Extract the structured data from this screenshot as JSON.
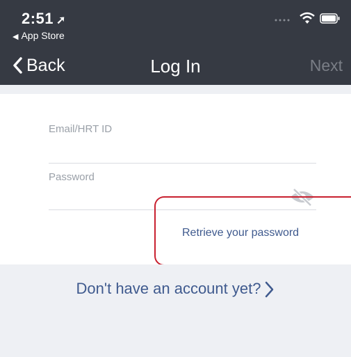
{
  "status": {
    "time": "2:51",
    "location_arrow": "➚",
    "back_app": "App Store"
  },
  "nav": {
    "back_label": "Back",
    "title": "Log In",
    "next_label": "Next"
  },
  "form": {
    "email_placeholder": "Email/HRT ID",
    "password_placeholder": "Password",
    "retrieve_label": "Retrieve your password"
  },
  "footer": {
    "signup_label": "Don't have an account yet?"
  },
  "colors": {
    "header": "#363a43",
    "link": "#3f5a8e",
    "highlight": "#c8202f",
    "panel": "#eef0f4"
  }
}
